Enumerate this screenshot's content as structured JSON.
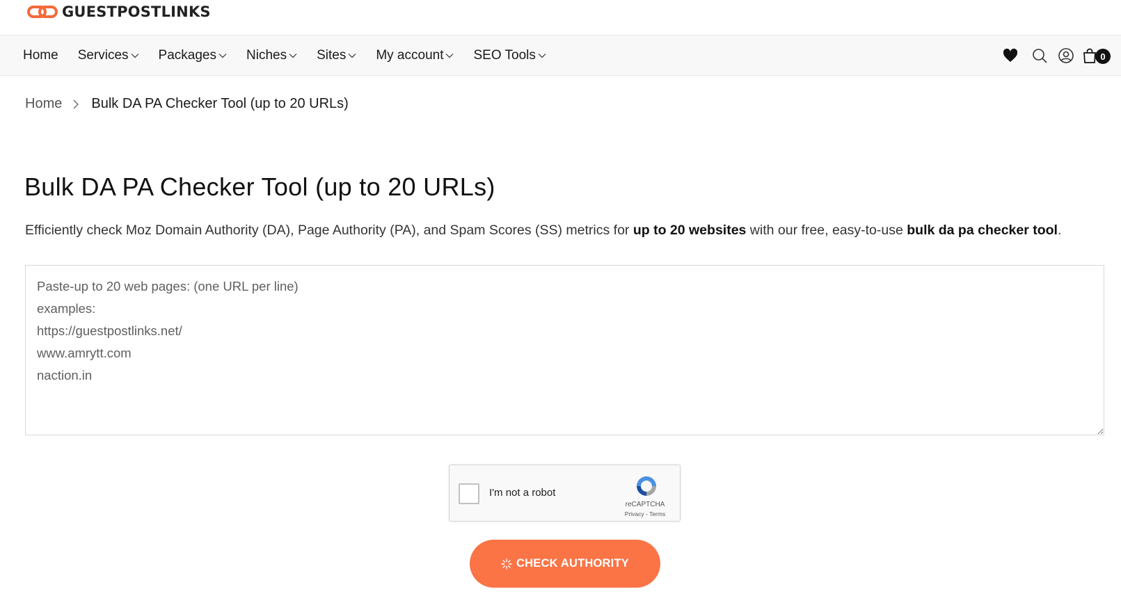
{
  "brand": {
    "name": "GUESTPOSTLINKS",
    "accent": "#f26b3a"
  },
  "nav": {
    "items": [
      {
        "label": "Home",
        "dropdown": false
      },
      {
        "label": "Services",
        "dropdown": true
      },
      {
        "label": "Packages",
        "dropdown": true
      },
      {
        "label": "Niches",
        "dropdown": true
      },
      {
        "label": "Sites",
        "dropdown": true
      },
      {
        "label": "My account",
        "dropdown": true
      },
      {
        "label": "SEO Tools",
        "dropdown": true
      }
    ],
    "icons": [
      "heart-icon",
      "search-icon",
      "user-icon",
      "cart-icon"
    ],
    "cart_count": "0"
  },
  "breadcrumb": {
    "home": "Home",
    "current": "Bulk DA PA Checker Tool (up to 20 URLs)"
  },
  "main": {
    "title": "Bulk DA PA Checker Tool (up to 20 URLs)",
    "intro_before": "Efficiently check Moz Domain Authority (DA), Page Authority (PA), and Spam Scores (SS) metrics for ",
    "intro_bold1": "up to 20 websites",
    "intro_middle": " with our free, easy-to-use ",
    "intro_bold2": "bulk da pa checker tool",
    "intro_after": ".",
    "textarea_placeholder": "Paste-up to 20 web pages: (one URL per line)\nexamples:\nhttps://guestpostlinks.net/\nwww.amrytt.com\nnaction.in",
    "textarea_value": ""
  },
  "recaptcha": {
    "label": "I'm not a robot",
    "brand": "reCAPTCHA",
    "links": "Privacy - Terms"
  },
  "button": {
    "label": "CHECK AUTHORITY",
    "color": "#fa7446"
  }
}
